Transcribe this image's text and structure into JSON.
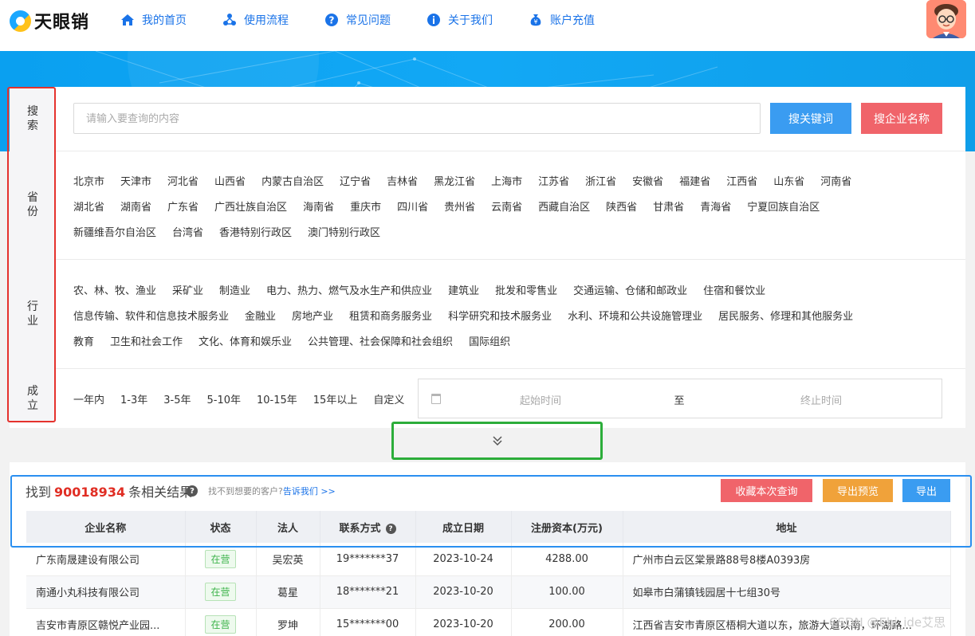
{
  "brand": {
    "name": "天眼销"
  },
  "nav": [
    {
      "label": "我的首页",
      "icon": "home-icon"
    },
    {
      "label": "使用流程",
      "icon": "flow-icon"
    },
    {
      "label": "常见问题",
      "icon": "question-icon"
    },
    {
      "label": "关于我们",
      "icon": "info-icon"
    },
    {
      "label": "账户充值",
      "icon": "wallet-icon"
    }
  ],
  "labels": {
    "search": "搜索",
    "province": "省份",
    "industry": "行业",
    "founded": "成立"
  },
  "search": {
    "placeholder": "请输入要查询的内容",
    "keyword_btn": "搜关键词",
    "company_btn": "搜企业名称"
  },
  "provinces": [
    [
      "北京市",
      "天津市",
      "河北省",
      "山西省",
      "内蒙古自治区",
      "辽宁省",
      "吉林省",
      "黑龙江省",
      "上海市",
      "江苏省",
      "浙江省",
      "安徽省",
      "福建省",
      "江西省",
      "山东省",
      "河南省"
    ],
    [
      "湖北省",
      "湖南省",
      "广东省",
      "广西壮族自治区",
      "海南省",
      "重庆市",
      "四川省",
      "贵州省",
      "云南省",
      "西藏自治区",
      "陕西省",
      "甘肃省",
      "青海省",
      "宁夏回族自治区"
    ],
    [
      "新疆维吾尔自治区",
      "台湾省",
      "香港特别行政区",
      "澳门特别行政区"
    ]
  ],
  "industries": [
    [
      "农、林、牧、渔业",
      "采矿业",
      "制造业",
      "电力、热力、燃气及水生产和供应业",
      "建筑业",
      "批发和零售业",
      "交通运输、仓储和邮政业",
      "住宿和餐饮业"
    ],
    [
      "信息传输、软件和信息技术服务业",
      "金融业",
      "房地产业",
      "租赁和商务服务业",
      "科学研究和技术服务业",
      "水利、环境和公共设施管理业",
      "居民服务、修理和其他服务业"
    ],
    [
      "教育",
      "卫生和社会工作",
      "文化、体育和娱乐业",
      "公共管理、社会保障和社会组织",
      "国际组织"
    ]
  ],
  "founded_options": [
    "一年内",
    "1-3年",
    "3-5年",
    "5-10年",
    "10-15年",
    "15年以上",
    "自定义"
  ],
  "date_range": {
    "start_placeholder": "起始时间",
    "separator": "至",
    "end_placeholder": "终止时间"
  },
  "results": {
    "prefix": "找到",
    "count": "90018934",
    "suffix": "条相关结果",
    "hint_text": "找不到想要的客户?",
    "hint_link": "告诉我们 >>",
    "save_btn": "收藏本次查询",
    "preview_btn": "导出预览",
    "export_btn": "导出",
    "columns": [
      "企业名称",
      "状态",
      "法人",
      "联系方式",
      "成立日期",
      "注册资本(万元)",
      "地址"
    ],
    "rows": [
      {
        "name": "广东南晟建设有限公司",
        "status": "在营",
        "legal": "吴宏英",
        "phone": "19*******37",
        "date": "2023-10-24",
        "capital": "4288.00",
        "address": "广州市白云区棠景路88号8楼A0393房"
      },
      {
        "name": "南通小丸科技有限公司",
        "status": "在营",
        "legal": "葛星",
        "phone": "18*******21",
        "date": "2023-10-20",
        "capital": "100.00",
        "address": "如皋市白蒲镇钱园居十七组30号"
      },
      {
        "name": "吉安市青原区赣悦产业园...",
        "status": "在营",
        "legal": "罗坤",
        "phone": "15*******00",
        "date": "2023-10-20",
        "capital": "200.00",
        "address": "江西省吉安市青原区梧桐大道以东，旅游大道以南，环湖路..."
      }
    ]
  },
  "watermark": "CSDN @Ebj_ide艾思"
}
